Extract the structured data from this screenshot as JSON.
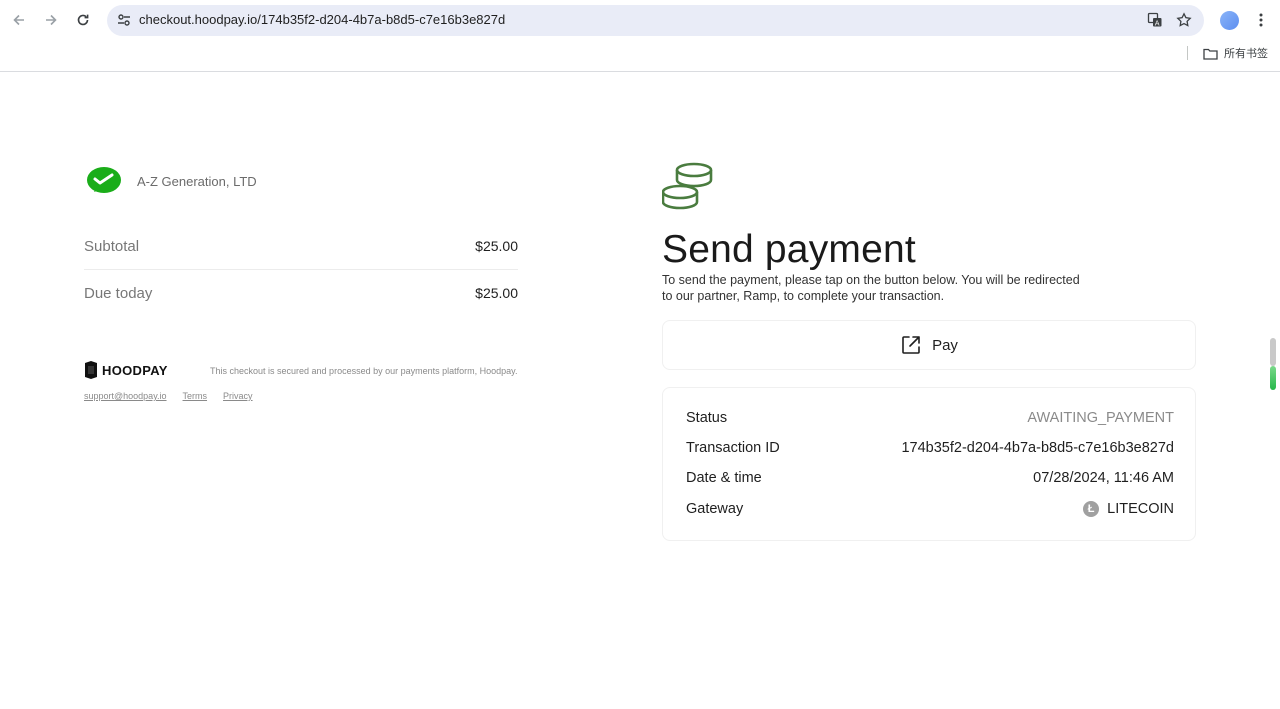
{
  "browser": {
    "url": "checkout.hoodpay.io/174b35f2-d204-4b7a-b8d5-c7e16b3e827d",
    "bookmarks_label": "所有书签"
  },
  "merchant": {
    "name": "A-Z Generation, LTD"
  },
  "summary": {
    "subtotal_label": "Subtotal",
    "subtotal_value": "$25.00",
    "due_label": "Due today",
    "due_value": "$25.00"
  },
  "footer": {
    "brand": "HOODPAY",
    "secure_text": "This checkout is secured and processed by our payments platform, Hoodpay.",
    "support_link": "support@hoodpay.io",
    "terms_link": "Terms",
    "privacy_link": "Privacy"
  },
  "payment": {
    "title": "Send payment",
    "description": "To send the payment, please tap on the button below. You will be redirected to our partner, Ramp, to complete your transaction.",
    "pay_label": "Pay",
    "accent_color": "#4a7c3f"
  },
  "details": {
    "status_label": "Status",
    "status_value": "AWAITING_PAYMENT",
    "txid_label": "Transaction ID",
    "txid_value": "174b35f2-d204-4b7a-b8d5-c7e16b3e827d",
    "datetime_label": "Date & time",
    "datetime_value": "07/28/2024, 11:46 AM",
    "gateway_label": "Gateway",
    "gateway_value": "LITECOIN",
    "gateway_icon": "litecoin-icon",
    "gateway_icon_glyph": "Ł"
  }
}
